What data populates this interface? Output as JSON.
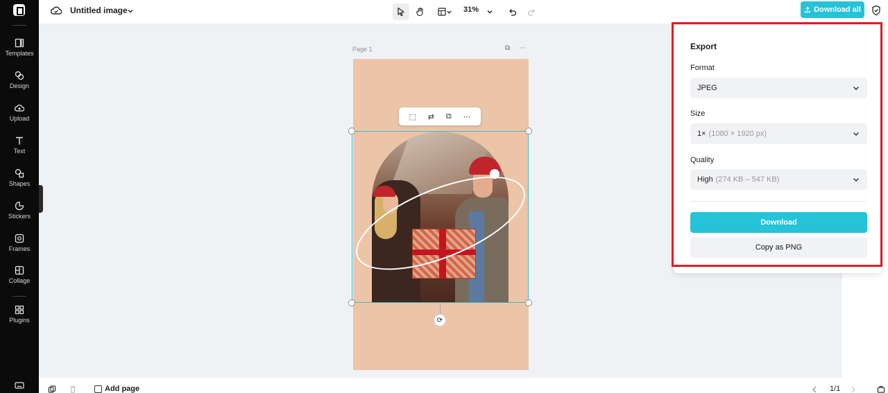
{
  "sidebar": {
    "items": [
      {
        "label": "Templates"
      },
      {
        "label": "Design"
      },
      {
        "label": "Upload"
      },
      {
        "label": "Text"
      },
      {
        "label": "Shapes"
      },
      {
        "label": "Stickers"
      },
      {
        "label": "Frames"
      },
      {
        "label": "Collage"
      },
      {
        "label": "Plugins"
      }
    ]
  },
  "topbar": {
    "title": "Untitled image",
    "zoom": "31%",
    "download_all": "Download all"
  },
  "canvas": {
    "page_label": "Page 1"
  },
  "export": {
    "title": "Export",
    "format_label": "Format",
    "format_value": "JPEG",
    "size_label": "Size",
    "size_value": "1×",
    "size_hint": "(1080 × 1920 px)",
    "quality_label": "Quality",
    "quality_value": "High",
    "quality_hint": "(274 KB – 547 KB)",
    "download_button": "Download",
    "copy_button": "Copy as PNG"
  },
  "bottombar": {
    "add_page": "Add page",
    "page_count": "1/1"
  },
  "colors": {
    "accent": "#24c3d8",
    "page_background": "#ecc5a9",
    "highlight_box": "#e01b24"
  }
}
